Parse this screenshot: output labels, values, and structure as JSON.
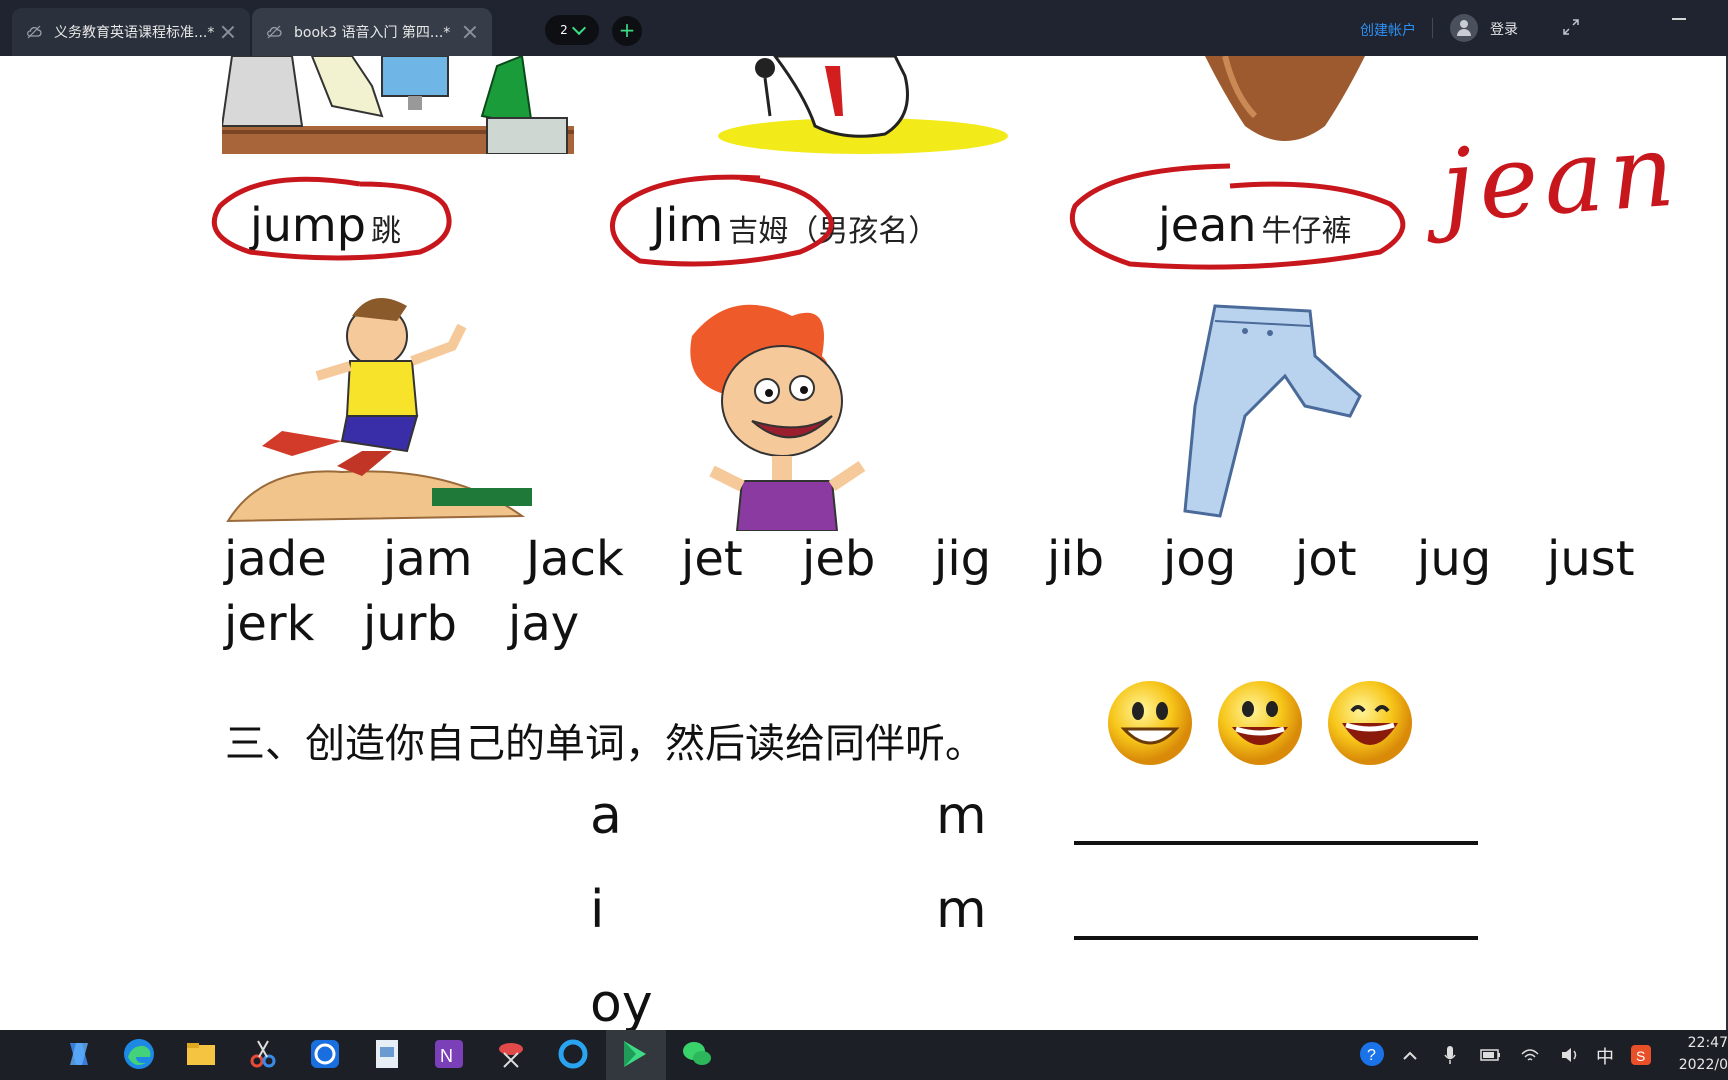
{
  "titlebar": {
    "tabs": [
      {
        "label": "义务教育英语课程标准...*"
      },
      {
        "label": "book3 语音入门 第四...*"
      }
    ],
    "page_indicator": "2",
    "add_label": "+",
    "create_account": "创建帐户",
    "login": "登录"
  },
  "slide": {
    "vocab": [
      {
        "word": "jump",
        "meaning": "跳"
      },
      {
        "word": "Jim",
        "meaning": "吉姆（男孩名）"
      },
      {
        "word": "jean",
        "meaning": "牛仔裤"
      }
    ],
    "handwritten_note": "jean",
    "word_row1": [
      "jade",
      "jam",
      "Jack",
      "jet",
      "jeb",
      "jig",
      "jib",
      "jog",
      "jot",
      "jug",
      "just"
    ],
    "word_row2": [
      "jerk",
      "jurb",
      "jay"
    ],
    "instruction": "三、创造你自己的单词，然后读给同伴听。",
    "builder": [
      {
        "vowel": "a",
        "end": "m"
      },
      {
        "vowel": "i",
        "end": "m"
      },
      {
        "vowel": "oy",
        "end": ""
      }
    ]
  },
  "taskbar": {
    "ime": "中",
    "time": "22:47",
    "date": "2022/0"
  },
  "colors": {
    "titlebar_bg": "#1f2430",
    "accent_green": "#3ddc84",
    "link_blue": "#2e8ff0",
    "annotation_red": "#c8161d",
    "taskbar_bg": "#1c2026"
  }
}
